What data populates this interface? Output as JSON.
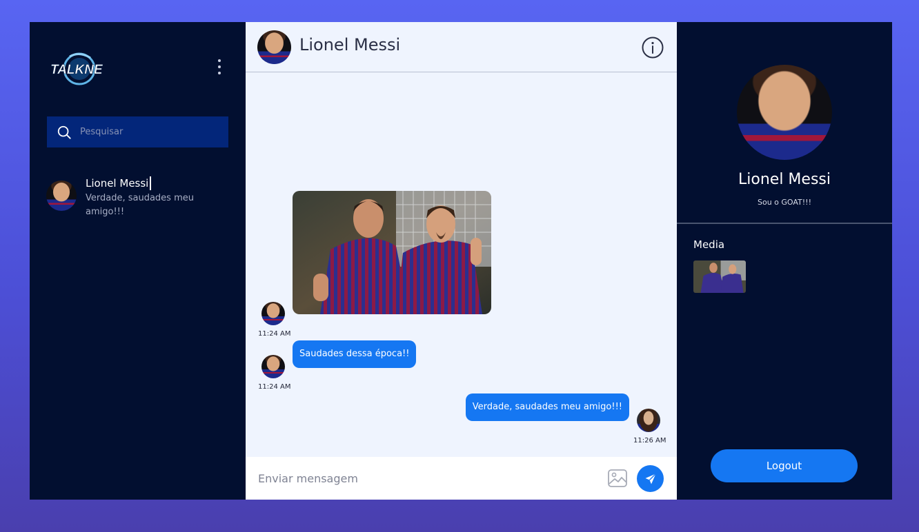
{
  "app": {
    "name": "TALKNET"
  },
  "sidebar": {
    "search_placeholder": "Pesquisar",
    "contacts": [
      {
        "name": "Lionel Messi",
        "preview": "Verdade, saudades meu amigo!!!"
      }
    ]
  },
  "chat": {
    "title": "Lionel Messi",
    "messages": [
      {
        "type": "image",
        "time": "11:24 AM"
      },
      {
        "type": "text",
        "text": "Saudades dessa época!!",
        "time": "11:24 AM"
      },
      {
        "type": "text",
        "text": "Verdade, saudades meu amigo!!!",
        "time": "11:26 AM"
      }
    ],
    "composer_placeholder": "Enviar mensagem"
  },
  "details": {
    "name": "Lionel Messi",
    "status": "Sou o GOAT!!!",
    "media_label": "Media",
    "logout_label": "Logout"
  },
  "colors": {
    "sidebar_bg": "#020f30",
    "search_bg": "#03267a",
    "chat_bg": "#eff4fe",
    "accent": "#1577f2"
  },
  "icons": [
    "kebab-menu-icon",
    "search-icon",
    "info-icon",
    "image-icon",
    "send-icon"
  ]
}
